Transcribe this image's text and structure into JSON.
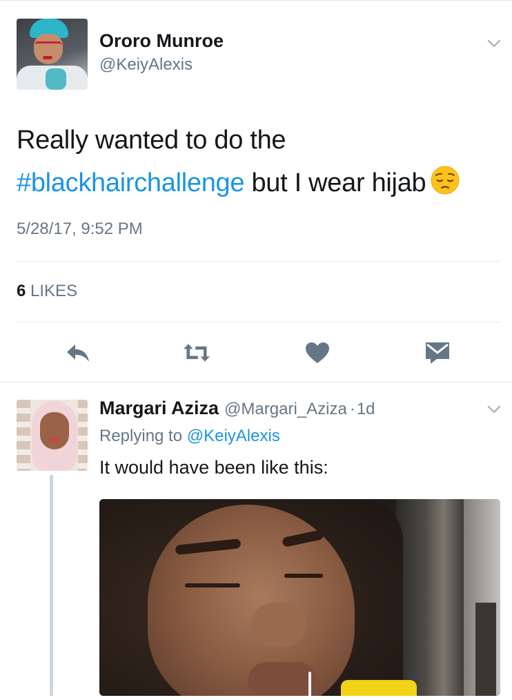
{
  "main_tweet": {
    "author_name": "Ororo Munroe",
    "author_handle": "@KeiyAlexis",
    "text_line1": "Really wanted to do the",
    "hashtag": "#blackhairchallenge",
    "text_after_hashtag": " but I wear hijab",
    "emoji": "pensive-face-emoji",
    "timestamp": "5/28/17, 9:52 PM",
    "likes_count": "6",
    "likes_label": "LIKES"
  },
  "actions": {
    "reply_icon": "reply-icon",
    "retweet_icon": "retweet-icon",
    "like_icon": "heart-icon",
    "dm_icon": "envelope-icon"
  },
  "reply_tweet": {
    "author_name": "Margari Aziza",
    "author_handle": "@Margari_Aziza",
    "separator": "·",
    "time": "1d",
    "replying_prefix": "Replying to",
    "replying_to": "@KeiyAlexis",
    "text": "It would have been like this:"
  },
  "colors": {
    "link": "#1b95e0",
    "secondary_text": "#657786",
    "primary_text": "#14171a",
    "icon": "#657786",
    "divider": "#e1e8ed"
  }
}
